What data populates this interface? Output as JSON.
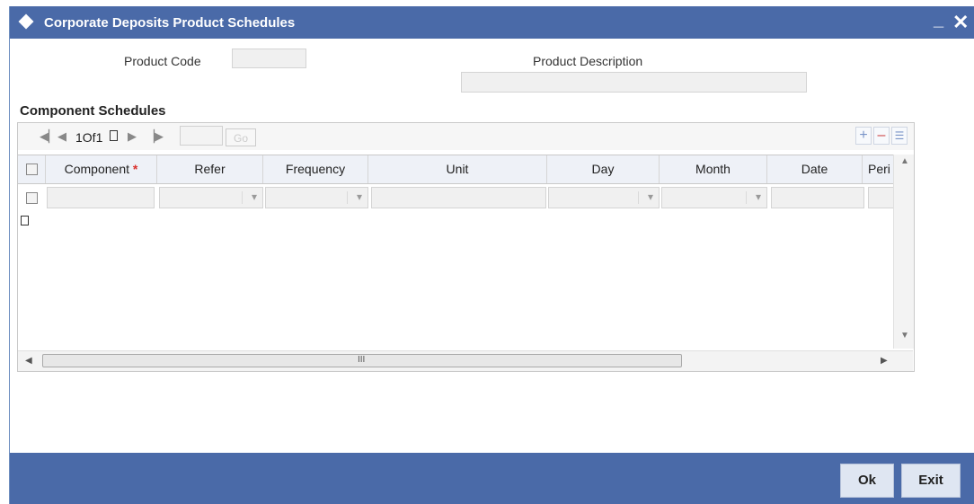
{
  "window": {
    "title": "Corporate Deposits Product Schedules",
    "minimize_glyph": "_",
    "close_glyph": "✕"
  },
  "form": {
    "product_code_label": "Product Code",
    "product_code_value": "",
    "product_description_label": "Product Description",
    "product_description_value": ""
  },
  "component_schedules": {
    "section_title": "Component Schedules",
    "pager": {
      "text": "1Of1",
      "page_input_value": "",
      "go_label": "Go"
    },
    "toolbar_icons": [
      "add-row-icon",
      "delete-row-icon",
      "single-record-view-icon"
    ],
    "columns": [
      "Component",
      "Refer",
      "Frequency",
      "Unit",
      "Day",
      "Month",
      "Date",
      "Peri"
    ],
    "required_marker": "*",
    "rows": [
      {
        "component": "",
        "refer": "",
        "frequency": "",
        "unit": "",
        "day": "",
        "month": "",
        "date": "",
        "peri": ""
      }
    ]
  },
  "footer": {
    "ok_label": "Ok",
    "exit_label": "Exit"
  },
  "colors": {
    "title_bar": "#4a6aa8",
    "footer_bar": "#4a6aa8",
    "required": "#d9302c",
    "header_bg": "#eef1f7"
  }
}
